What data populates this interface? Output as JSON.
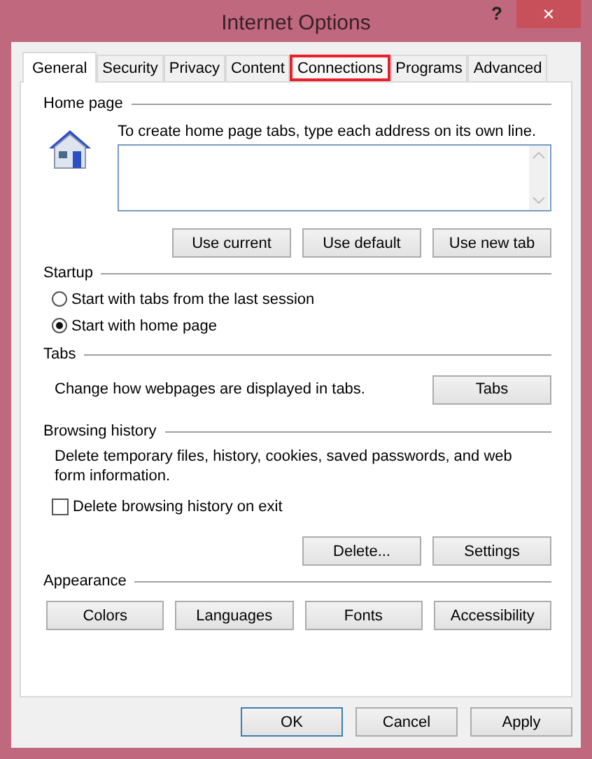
{
  "window": {
    "title": "Internet Options",
    "help": "?",
    "close": "✕"
  },
  "tabs": [
    {
      "label": "General",
      "selected": true,
      "highlighted": false
    },
    {
      "label": "Security",
      "selected": false,
      "highlighted": false
    },
    {
      "label": "Privacy",
      "selected": false,
      "highlighted": false
    },
    {
      "label": "Content",
      "selected": false,
      "highlighted": false
    },
    {
      "label": "Connections",
      "selected": false,
      "highlighted": true
    },
    {
      "label": "Programs",
      "selected": false,
      "highlighted": false
    },
    {
      "label": "Advanced",
      "selected": false,
      "highlighted": false
    }
  ],
  "home_page": {
    "label": "Home page",
    "hint": "To create home page tabs, type each address on its own line.",
    "buttons": [
      "Use current",
      "Use default",
      "Use new tab"
    ]
  },
  "startup": {
    "label": "Startup",
    "options": [
      {
        "label": "Start with tabs from the last session",
        "selected": false
      },
      {
        "label": "Start with home page",
        "selected": true
      }
    ]
  },
  "tabs_section": {
    "label": "Tabs",
    "description": "Change how webpages are displayed in tabs.",
    "button": "Tabs"
  },
  "browsing_history": {
    "label": "Browsing history",
    "description": "Delete temporary files, history, cookies, saved passwords, and web form information.",
    "delete_on_exit": {
      "label": "Delete browsing history on exit",
      "checked": false
    },
    "buttons": [
      "Delete...",
      "Settings"
    ]
  },
  "appearance": {
    "label": "Appearance",
    "buttons": [
      "Colors",
      "Languages",
      "Fonts",
      "Accessibility"
    ]
  },
  "dialog_buttons": [
    {
      "label": "OK",
      "default": true
    },
    {
      "label": "Cancel",
      "default": false
    },
    {
      "label": "Apply",
      "default": false
    }
  ]
}
